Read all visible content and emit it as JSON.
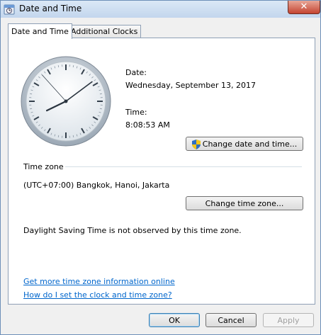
{
  "window": {
    "title": "Date and Time",
    "close_label": "✕"
  },
  "tabs": [
    {
      "label": "Date and Time",
      "active": true
    },
    {
      "label": "Additional Clocks",
      "active": false
    }
  ],
  "date": {
    "label": "Date:",
    "value": "Wednesday, September 13, 2017"
  },
  "time": {
    "label": "Time:",
    "value": "8:08:53 AM"
  },
  "clock": {
    "hours": 8,
    "minutes": 8,
    "seconds": 53
  },
  "change_date_button": "Change date and time...",
  "timezone": {
    "section_label": "Time zone",
    "value": "(UTC+07:00) Bangkok, Hanoi, Jakarta",
    "change_button": "Change time zone...",
    "dst_note": "Daylight Saving Time is not observed by this time zone."
  },
  "links": {
    "more_info": "Get more time zone information online",
    "how_to": "How do I set the clock and time zone?"
  },
  "footer": {
    "ok": "OK",
    "cancel": "Cancel",
    "apply": "Apply"
  }
}
